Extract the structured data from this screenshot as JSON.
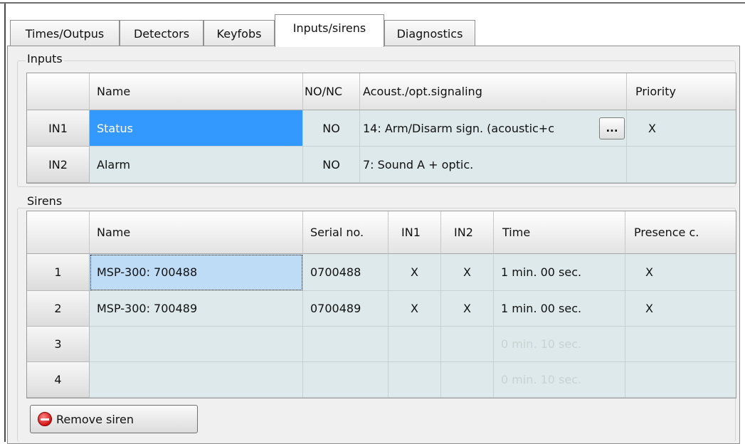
{
  "tabs": [
    {
      "label": "Times/Outpus"
    },
    {
      "label": "Detectors"
    },
    {
      "label": "Keyfobs"
    },
    {
      "label": "Inputs/sirens",
      "active": true
    },
    {
      "label": "Diagnostics"
    }
  ],
  "inputs": {
    "title": "Inputs",
    "columns": [
      "Name",
      "NO/NC",
      "Acoust./opt.signaling",
      "Priority"
    ],
    "rows": [
      {
        "id": "IN1",
        "name": "Status",
        "nonc": "NO",
        "signaling": "14: Arm/Disarm sign. (acoustic+c",
        "priority": "X"
      },
      {
        "id": "IN2",
        "name": "Alarm",
        "nonc": "NO",
        "signaling": "7: Sound A + optic.",
        "priority": ""
      }
    ],
    "ellipsis_label": "..."
  },
  "sirens": {
    "title": "Sirens",
    "columns": [
      "Name",
      "Serial no.",
      "IN1",
      "IN2",
      "Time",
      "Presence c."
    ],
    "rows": [
      {
        "id": "1",
        "name": "MSP-300: 700488",
        "serial": "0700488",
        "in1": "X",
        "in2": "X",
        "time": "1 min. 00 sec.",
        "presence": "X"
      },
      {
        "id": "2",
        "name": "MSP-300: 700489",
        "serial": "0700489",
        "in1": "X",
        "in2": "X",
        "time": "1 min. 00 sec.",
        "presence": "X"
      },
      {
        "id": "3",
        "name": "",
        "serial": "",
        "in1": "",
        "in2": "",
        "time": "0 min. 10 sec.",
        "presence": ""
      },
      {
        "id": "4",
        "name": "",
        "serial": "",
        "in1": "",
        "in2": "",
        "time": "0 min. 10 sec.",
        "presence": ""
      }
    ],
    "remove_label": "Remove siren"
  },
  "colors": {
    "selection": "#3399ff",
    "grid_bg": "#dde9ea",
    "panel_bg": "#f0f0f0"
  }
}
